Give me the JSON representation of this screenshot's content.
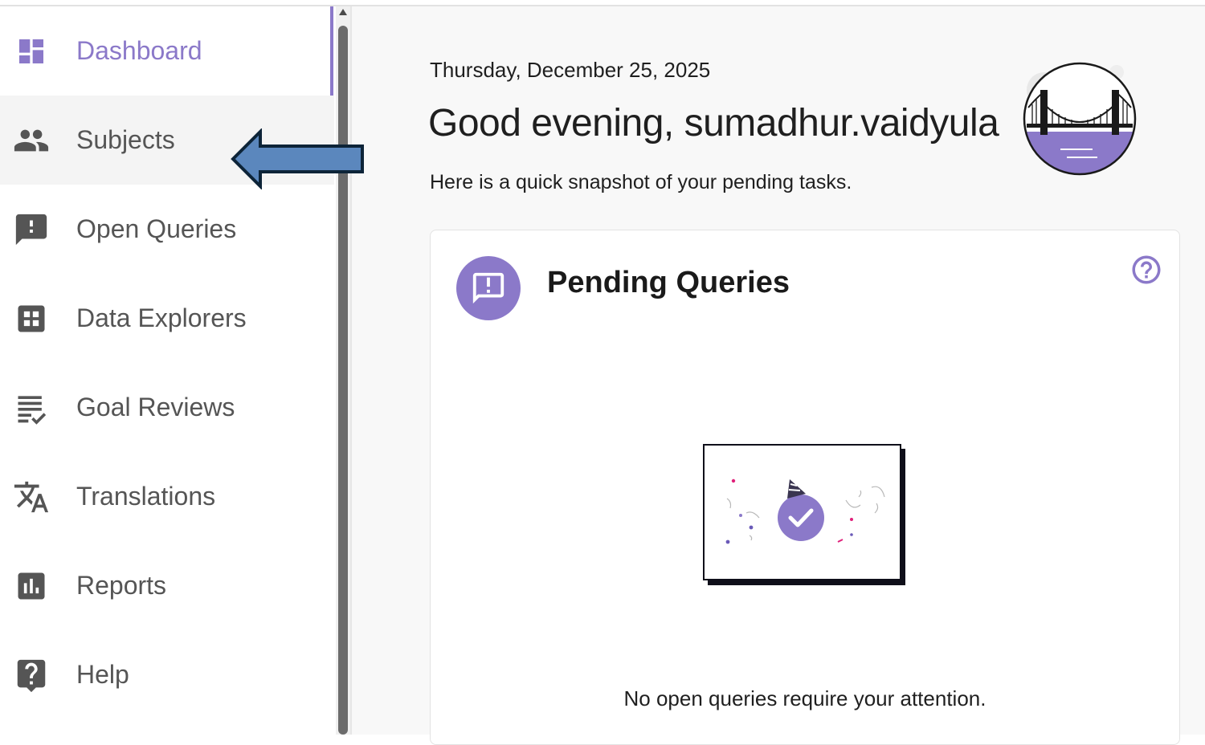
{
  "sidebar": {
    "items": [
      {
        "label": "Dashboard",
        "icon": "dashboard-icon",
        "active": true
      },
      {
        "label": "Subjects",
        "icon": "people-icon",
        "hover": true
      },
      {
        "label": "Open Queries",
        "icon": "feedback-icon"
      },
      {
        "label": "Data Explorers",
        "icon": "grid-icon"
      },
      {
        "label": "Goal Reviews",
        "icon": "checklist-icon"
      },
      {
        "label": "Translations",
        "icon": "translate-icon"
      },
      {
        "label": "Reports",
        "icon": "bar-chart-icon"
      },
      {
        "label": "Help",
        "icon": "help-icon"
      }
    ]
  },
  "main": {
    "date": "Thursday, December 25, 2025",
    "greeting": "Good evening, sumadhur.vaidyula",
    "subtitle": "Here is a quick snapshot of your pending tasks.",
    "card": {
      "title": "Pending Queries",
      "empty_message": "No open queries require your attention."
    }
  },
  "colors": {
    "accent": "#8b79c9",
    "text": "#1f1f1f",
    "nav_text": "#555555",
    "arrow_fill": "#5b87bd",
    "arrow_stroke": "#0d2438"
  }
}
